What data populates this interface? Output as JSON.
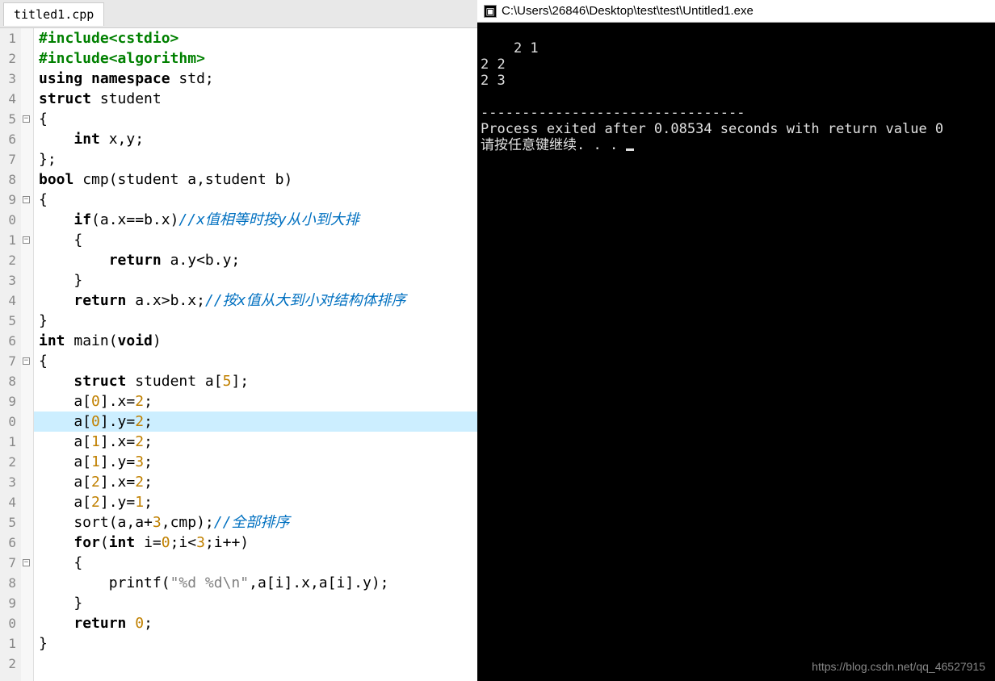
{
  "editor": {
    "tab": "titled1.cpp",
    "lines": [
      {
        "n": "1",
        "tokens": [
          {
            "t": "#include<cstdio>",
            "c": "pp"
          }
        ]
      },
      {
        "n": "2",
        "tokens": [
          {
            "t": "#include<algorithm>",
            "c": "pp"
          }
        ]
      },
      {
        "n": "3",
        "tokens": [
          {
            "t": "using namespace",
            "c": "kw"
          },
          {
            "t": " std;",
            "c": ""
          }
        ]
      },
      {
        "n": "4",
        "tokens": [
          {
            "t": "struct",
            "c": "kw"
          },
          {
            "t": " student",
            "c": ""
          }
        ]
      },
      {
        "n": "5",
        "fold": "open",
        "tokens": [
          {
            "t": "{",
            "c": "op"
          }
        ]
      },
      {
        "n": "6",
        "tokens": [
          {
            "t": "    ",
            "c": ""
          },
          {
            "t": "int",
            "c": "kw"
          },
          {
            "t": " x,y;",
            "c": ""
          }
        ]
      },
      {
        "n": "7",
        "tokens": [
          {
            "t": "};",
            "c": "op"
          }
        ]
      },
      {
        "n": "8",
        "tokens": [
          {
            "t": "bool",
            "c": "kw"
          },
          {
            "t": " cmp(student a,student b)",
            "c": ""
          }
        ]
      },
      {
        "n": "9",
        "fold": "open",
        "tokens": [
          {
            "t": "{",
            "c": "op"
          }
        ]
      },
      {
        "n": "0",
        "tokens": [
          {
            "t": "    ",
            "c": ""
          },
          {
            "t": "if",
            "c": "kw"
          },
          {
            "t": "(a.x==b.x)",
            "c": ""
          },
          {
            "t": "//x值相等时按y从小到大排",
            "c": "cm"
          }
        ]
      },
      {
        "n": "1",
        "fold": "open",
        "tokens": [
          {
            "t": "    {",
            "c": "op"
          }
        ]
      },
      {
        "n": "2",
        "tokens": [
          {
            "t": "        ",
            "c": ""
          },
          {
            "t": "return",
            "c": "kw"
          },
          {
            "t": " a.y<b.y;",
            "c": ""
          }
        ]
      },
      {
        "n": "3",
        "tokens": [
          {
            "t": "    }",
            "c": "op"
          }
        ]
      },
      {
        "n": "4",
        "tokens": [
          {
            "t": "    ",
            "c": ""
          },
          {
            "t": "return",
            "c": "kw"
          },
          {
            "t": " a.x>b.x;",
            "c": ""
          },
          {
            "t": "//按x值从大到小对结构体排序",
            "c": "cm"
          }
        ]
      },
      {
        "n": "5",
        "tokens": [
          {
            "t": "}",
            "c": "op"
          }
        ]
      },
      {
        "n": "6",
        "tokens": [
          {
            "t": "int",
            "c": "kw"
          },
          {
            "t": " main(",
            "c": ""
          },
          {
            "t": "void",
            "c": "kw"
          },
          {
            "t": ")",
            "c": ""
          }
        ]
      },
      {
        "n": "7",
        "fold": "open",
        "tokens": [
          {
            "t": "{",
            "c": "op"
          }
        ]
      },
      {
        "n": "8",
        "tokens": [
          {
            "t": "    ",
            "c": ""
          },
          {
            "t": "struct",
            "c": "kw"
          },
          {
            "t": " student a[",
            "c": ""
          },
          {
            "t": "5",
            "c": "num"
          },
          {
            "t": "];",
            "c": ""
          }
        ]
      },
      {
        "n": "9",
        "tokens": [
          {
            "t": "    a[",
            "c": ""
          },
          {
            "t": "0",
            "c": "num"
          },
          {
            "t": "].x=",
            "c": ""
          },
          {
            "t": "2",
            "c": "num"
          },
          {
            "t": ";",
            "c": ""
          }
        ]
      },
      {
        "n": "0",
        "hl": true,
        "tokens": [
          {
            "t": "    a[",
            "c": ""
          },
          {
            "t": "0",
            "c": "num"
          },
          {
            "t": "].y=",
            "c": ""
          },
          {
            "t": "2",
            "c": "num"
          },
          {
            "t": ";",
            "c": ""
          }
        ]
      },
      {
        "n": "1",
        "tokens": [
          {
            "t": "    a[",
            "c": ""
          },
          {
            "t": "1",
            "c": "num"
          },
          {
            "t": "].x=",
            "c": ""
          },
          {
            "t": "2",
            "c": "num"
          },
          {
            "t": ";",
            "c": ""
          }
        ]
      },
      {
        "n": "2",
        "tokens": [
          {
            "t": "    a[",
            "c": ""
          },
          {
            "t": "1",
            "c": "num"
          },
          {
            "t": "].y=",
            "c": ""
          },
          {
            "t": "3",
            "c": "num"
          },
          {
            "t": ";",
            "c": ""
          }
        ]
      },
      {
        "n": "3",
        "tokens": [
          {
            "t": "    a[",
            "c": ""
          },
          {
            "t": "2",
            "c": "num"
          },
          {
            "t": "].x=",
            "c": ""
          },
          {
            "t": "2",
            "c": "num"
          },
          {
            "t": ";",
            "c": ""
          }
        ]
      },
      {
        "n": "4",
        "tokens": [
          {
            "t": "    a[",
            "c": ""
          },
          {
            "t": "2",
            "c": "num"
          },
          {
            "t": "].y=",
            "c": ""
          },
          {
            "t": "1",
            "c": "num"
          },
          {
            "t": ";",
            "c": ""
          }
        ]
      },
      {
        "n": "5",
        "tokens": [
          {
            "t": "    sort(a,a+",
            "c": ""
          },
          {
            "t": "3",
            "c": "num"
          },
          {
            "t": ",cmp);",
            "c": ""
          },
          {
            "t": "//全部排序",
            "c": "cm"
          }
        ]
      },
      {
        "n": "6",
        "tokens": [
          {
            "t": "    ",
            "c": ""
          },
          {
            "t": "for",
            "c": "kw"
          },
          {
            "t": "(",
            "c": ""
          },
          {
            "t": "int",
            "c": "kw"
          },
          {
            "t": " i=",
            "c": ""
          },
          {
            "t": "0",
            "c": "num"
          },
          {
            "t": ";i<",
            "c": ""
          },
          {
            "t": "3",
            "c": "num"
          },
          {
            "t": ";i++)",
            "c": ""
          }
        ]
      },
      {
        "n": "7",
        "fold": "open",
        "tokens": [
          {
            "t": "    {",
            "c": "op"
          }
        ]
      },
      {
        "n": "8",
        "tokens": [
          {
            "t": "        printf(",
            "c": ""
          },
          {
            "t": "\"%d %d\\n\"",
            "c": "str"
          },
          {
            "t": ",a[i].x,a[i].y);",
            "c": ""
          }
        ]
      },
      {
        "n": "9",
        "tokens": [
          {
            "t": "    }",
            "c": "op"
          }
        ]
      },
      {
        "n": "0",
        "tokens": [
          {
            "t": "    ",
            "c": ""
          },
          {
            "t": "return",
            "c": "kw"
          },
          {
            "t": " ",
            "c": ""
          },
          {
            "t": "0",
            "c": "num"
          },
          {
            "t": ";",
            "c": ""
          }
        ]
      },
      {
        "n": "1",
        "tokens": [
          {
            "t": "}",
            "c": "op"
          }
        ]
      },
      {
        "n": "2",
        "tokens": []
      }
    ]
  },
  "console": {
    "title": "C:\\Users\\26846\\Desktop\\test\\test\\Untitled1.exe",
    "output": "2 1\n2 2\n2 3\n\n--------------------------------\nProcess exited after 0.08534 seconds with return value 0\n请按任意键继续. . . ",
    "watermark": "https://blog.csdn.net/qq_46527915"
  }
}
